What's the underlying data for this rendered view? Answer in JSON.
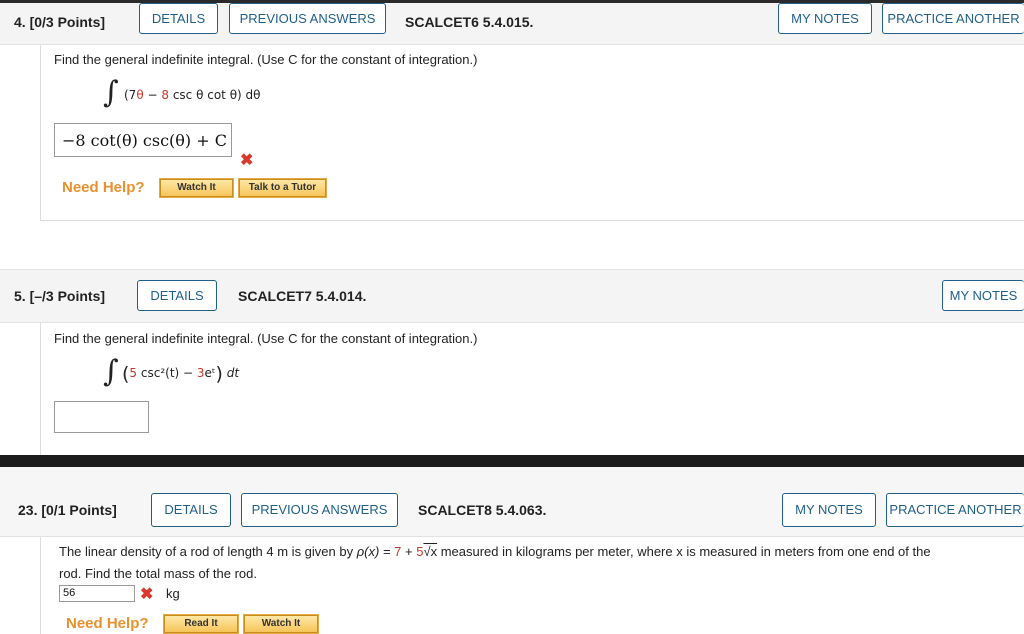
{
  "q4": {
    "number": "4.",
    "points": "[0/3 Points]",
    "details": "DETAILS",
    "previous_answers": "PREVIOUS ANSWERS",
    "code": "SCALCET6 5.4.015.",
    "my_notes": "MY NOTES",
    "practice_another": "PRACTICE ANOTHER",
    "prompt": "Find the general indefinite integral. (Use C for the constant of integration.)",
    "integral_open": "(7",
    "integral_theta": "θ",
    "integral_minus": " − ",
    "integral_coef": "8",
    "integral_rest": " csc θ cot θ) dθ",
    "answer": "−8 cot(θ) csc(θ) + C",
    "need_help": "Need Help?",
    "watch_it": "Watch It",
    "talk_tutor": "Talk to a Tutor"
  },
  "q5": {
    "number": "5.",
    "points": "[–/3 Points]",
    "details": "DETAILS",
    "code": "SCALCET7 5.4.014.",
    "my_notes": "MY NOTES",
    "prompt": "Find the general indefinite integral. (Use C for the constant of integration.)",
    "coef1": "5",
    "term1": " csc²(t) − ",
    "coef2": "3",
    "term2": "eᵗ",
    "dt": "dt",
    "answer": ""
  },
  "q23": {
    "number": "23.",
    "points": "[0/1 Points]",
    "details": "DETAILS",
    "previous_answers": "PREVIOUS ANSWERS",
    "code": "SCALCET8 5.4.063.",
    "my_notes": "MY NOTES",
    "practice_another": "PRACTICE ANOTHER",
    "line1_a": "The linear density of a rod of length 4 m is given by ",
    "rho": "ρ(x) = ",
    "c7": "7",
    "plus": " + ",
    "c5": "5",
    "sqrtx": "√x",
    "line1_b": " measured in kilograms per meter, where x is measured in meters from one end of the",
    "line2": "rod. Find the total mass of the rod.",
    "answer": "56",
    "unit": "kg",
    "need_help": "Need Help?",
    "read_it": "Read It",
    "watch_it": "Watch It"
  },
  "colors": {
    "accent": "#1f5f8a",
    "error": "#d9382b",
    "help": "#e8912d",
    "header_bg": "#f4f4f4"
  }
}
